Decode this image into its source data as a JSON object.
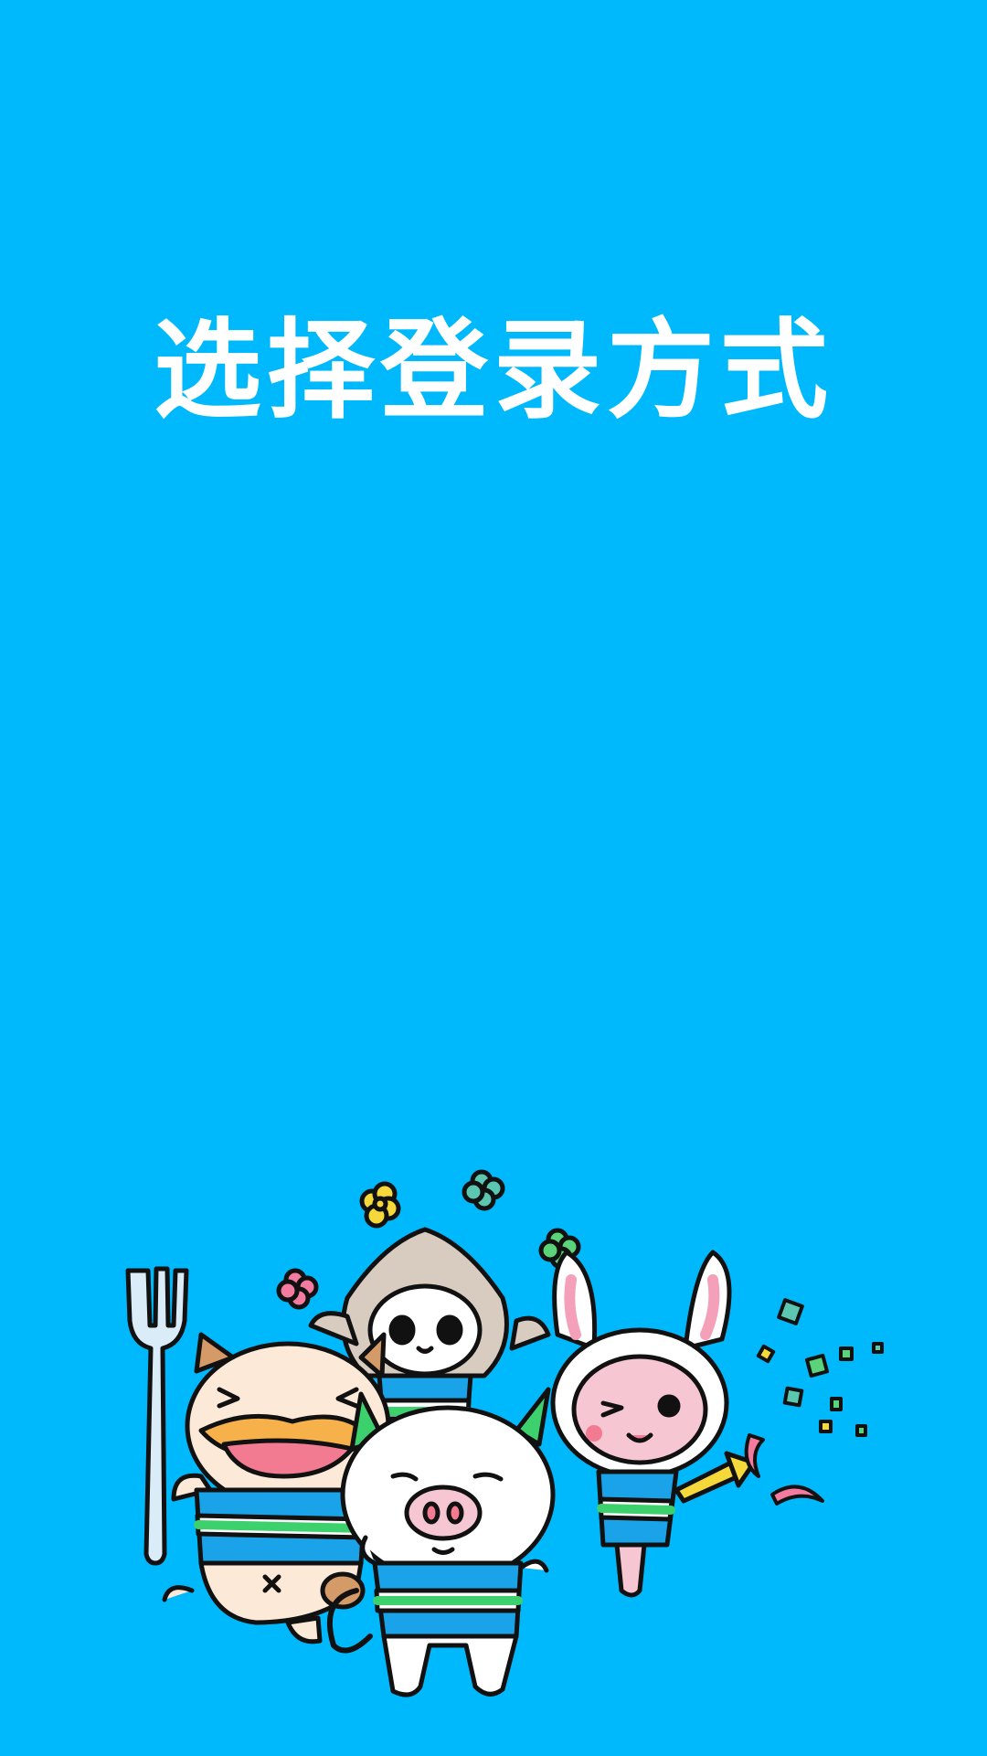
{
  "screen": {
    "title": "选择登录方式",
    "background_color": "#00B9FC"
  },
  "illustration": {
    "characters": [
      "duck-cat",
      "hooded-panda",
      "pig",
      "bunny"
    ],
    "props": [
      "fork",
      "party-horn",
      "confetti",
      "flowers"
    ]
  }
}
